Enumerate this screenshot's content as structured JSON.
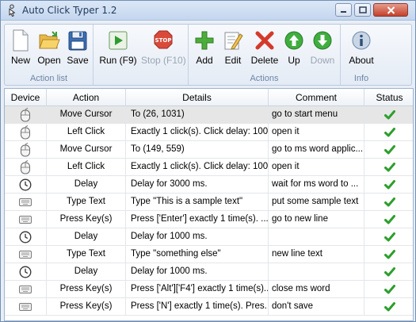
{
  "window": {
    "title": "Auto Click Typer 1.2"
  },
  "toolbar": {
    "groups": [
      {
        "label": "Action list",
        "buttons": [
          {
            "label": "New",
            "icon": "new-document-icon"
          },
          {
            "label": "Open",
            "icon": "open-folder-icon"
          },
          {
            "label": "Save",
            "icon": "save-disk-icon"
          }
        ]
      },
      {
        "label": "",
        "buttons": [
          {
            "label": "Run (F9)",
            "icon": "run-play-icon"
          },
          {
            "label": "Stop (F10)",
            "icon": "stop-sign-icon",
            "disabled": true
          }
        ]
      },
      {
        "label": "Actions",
        "buttons": [
          {
            "label": "Add",
            "icon": "add-plus-icon"
          },
          {
            "label": "Edit",
            "icon": "edit-pencil-icon"
          },
          {
            "label": "Delete",
            "icon": "delete-x-icon"
          },
          {
            "label": "Up",
            "icon": "arrow-up-icon"
          },
          {
            "label": "Down",
            "icon": "arrow-down-icon",
            "disabled": true
          }
        ]
      },
      {
        "label": "Info",
        "buttons": [
          {
            "label": "About",
            "icon": "about-info-icon"
          }
        ]
      }
    ]
  },
  "table": {
    "columns": [
      "Device",
      "Action",
      "Details",
      "Comment",
      "Status"
    ],
    "rows": [
      {
        "device": "mouse",
        "action": "Move Cursor",
        "details": "To (26, 1031)",
        "comment": "go to start menu",
        "status": "ok"
      },
      {
        "device": "mouse",
        "action": "Left Click",
        "details": "Exactly 1 click(s). Click delay: 100...",
        "comment": "open it",
        "status": "ok"
      },
      {
        "device": "mouse",
        "action": "Move Cursor",
        "details": "To (149, 559)",
        "comment": "go to ms word applic...",
        "status": "ok"
      },
      {
        "device": "mouse",
        "action": "Left Click",
        "details": "Exactly 1 click(s). Click delay: 100...",
        "comment": "open it",
        "status": "ok"
      },
      {
        "device": "clock",
        "action": "Delay",
        "details": "Delay for 3000 ms.",
        "comment": "wait for ms word to ...",
        "status": "ok"
      },
      {
        "device": "keyboard",
        "action": "Type Text",
        "details": "Type \"This is a sample text\"",
        "comment": "put some sample text",
        "status": "ok"
      },
      {
        "device": "keyboard",
        "action": "Press Key(s)",
        "details": "Press ['Enter'] exactly 1 time(s). ...",
        "comment": "go to new line",
        "status": "ok"
      },
      {
        "device": "clock",
        "action": "Delay",
        "details": "Delay for 1000 ms.",
        "comment": "",
        "status": "ok"
      },
      {
        "device": "keyboard",
        "action": "Type Text",
        "details": "Type \"something else\"",
        "comment": "new line text",
        "status": "ok"
      },
      {
        "device": "clock",
        "action": "Delay",
        "details": "Delay for 1000 ms.",
        "comment": "",
        "status": "ok"
      },
      {
        "device": "keyboard",
        "action": "Press Key(s)",
        "details": "Press ['Alt']['F4'] exactly 1 time(s)....",
        "comment": "close ms word",
        "status": "ok"
      },
      {
        "device": "keyboard",
        "action": "Press Key(s)",
        "details": "Press ['N'] exactly 1 time(s). Pres...",
        "comment": "don't save",
        "status": "ok"
      }
    ],
    "selected_row": 0
  },
  "colors": {
    "status_ok": "#2e9e2e",
    "title_text": "#1e395b",
    "group_label": "#6b86a8"
  }
}
